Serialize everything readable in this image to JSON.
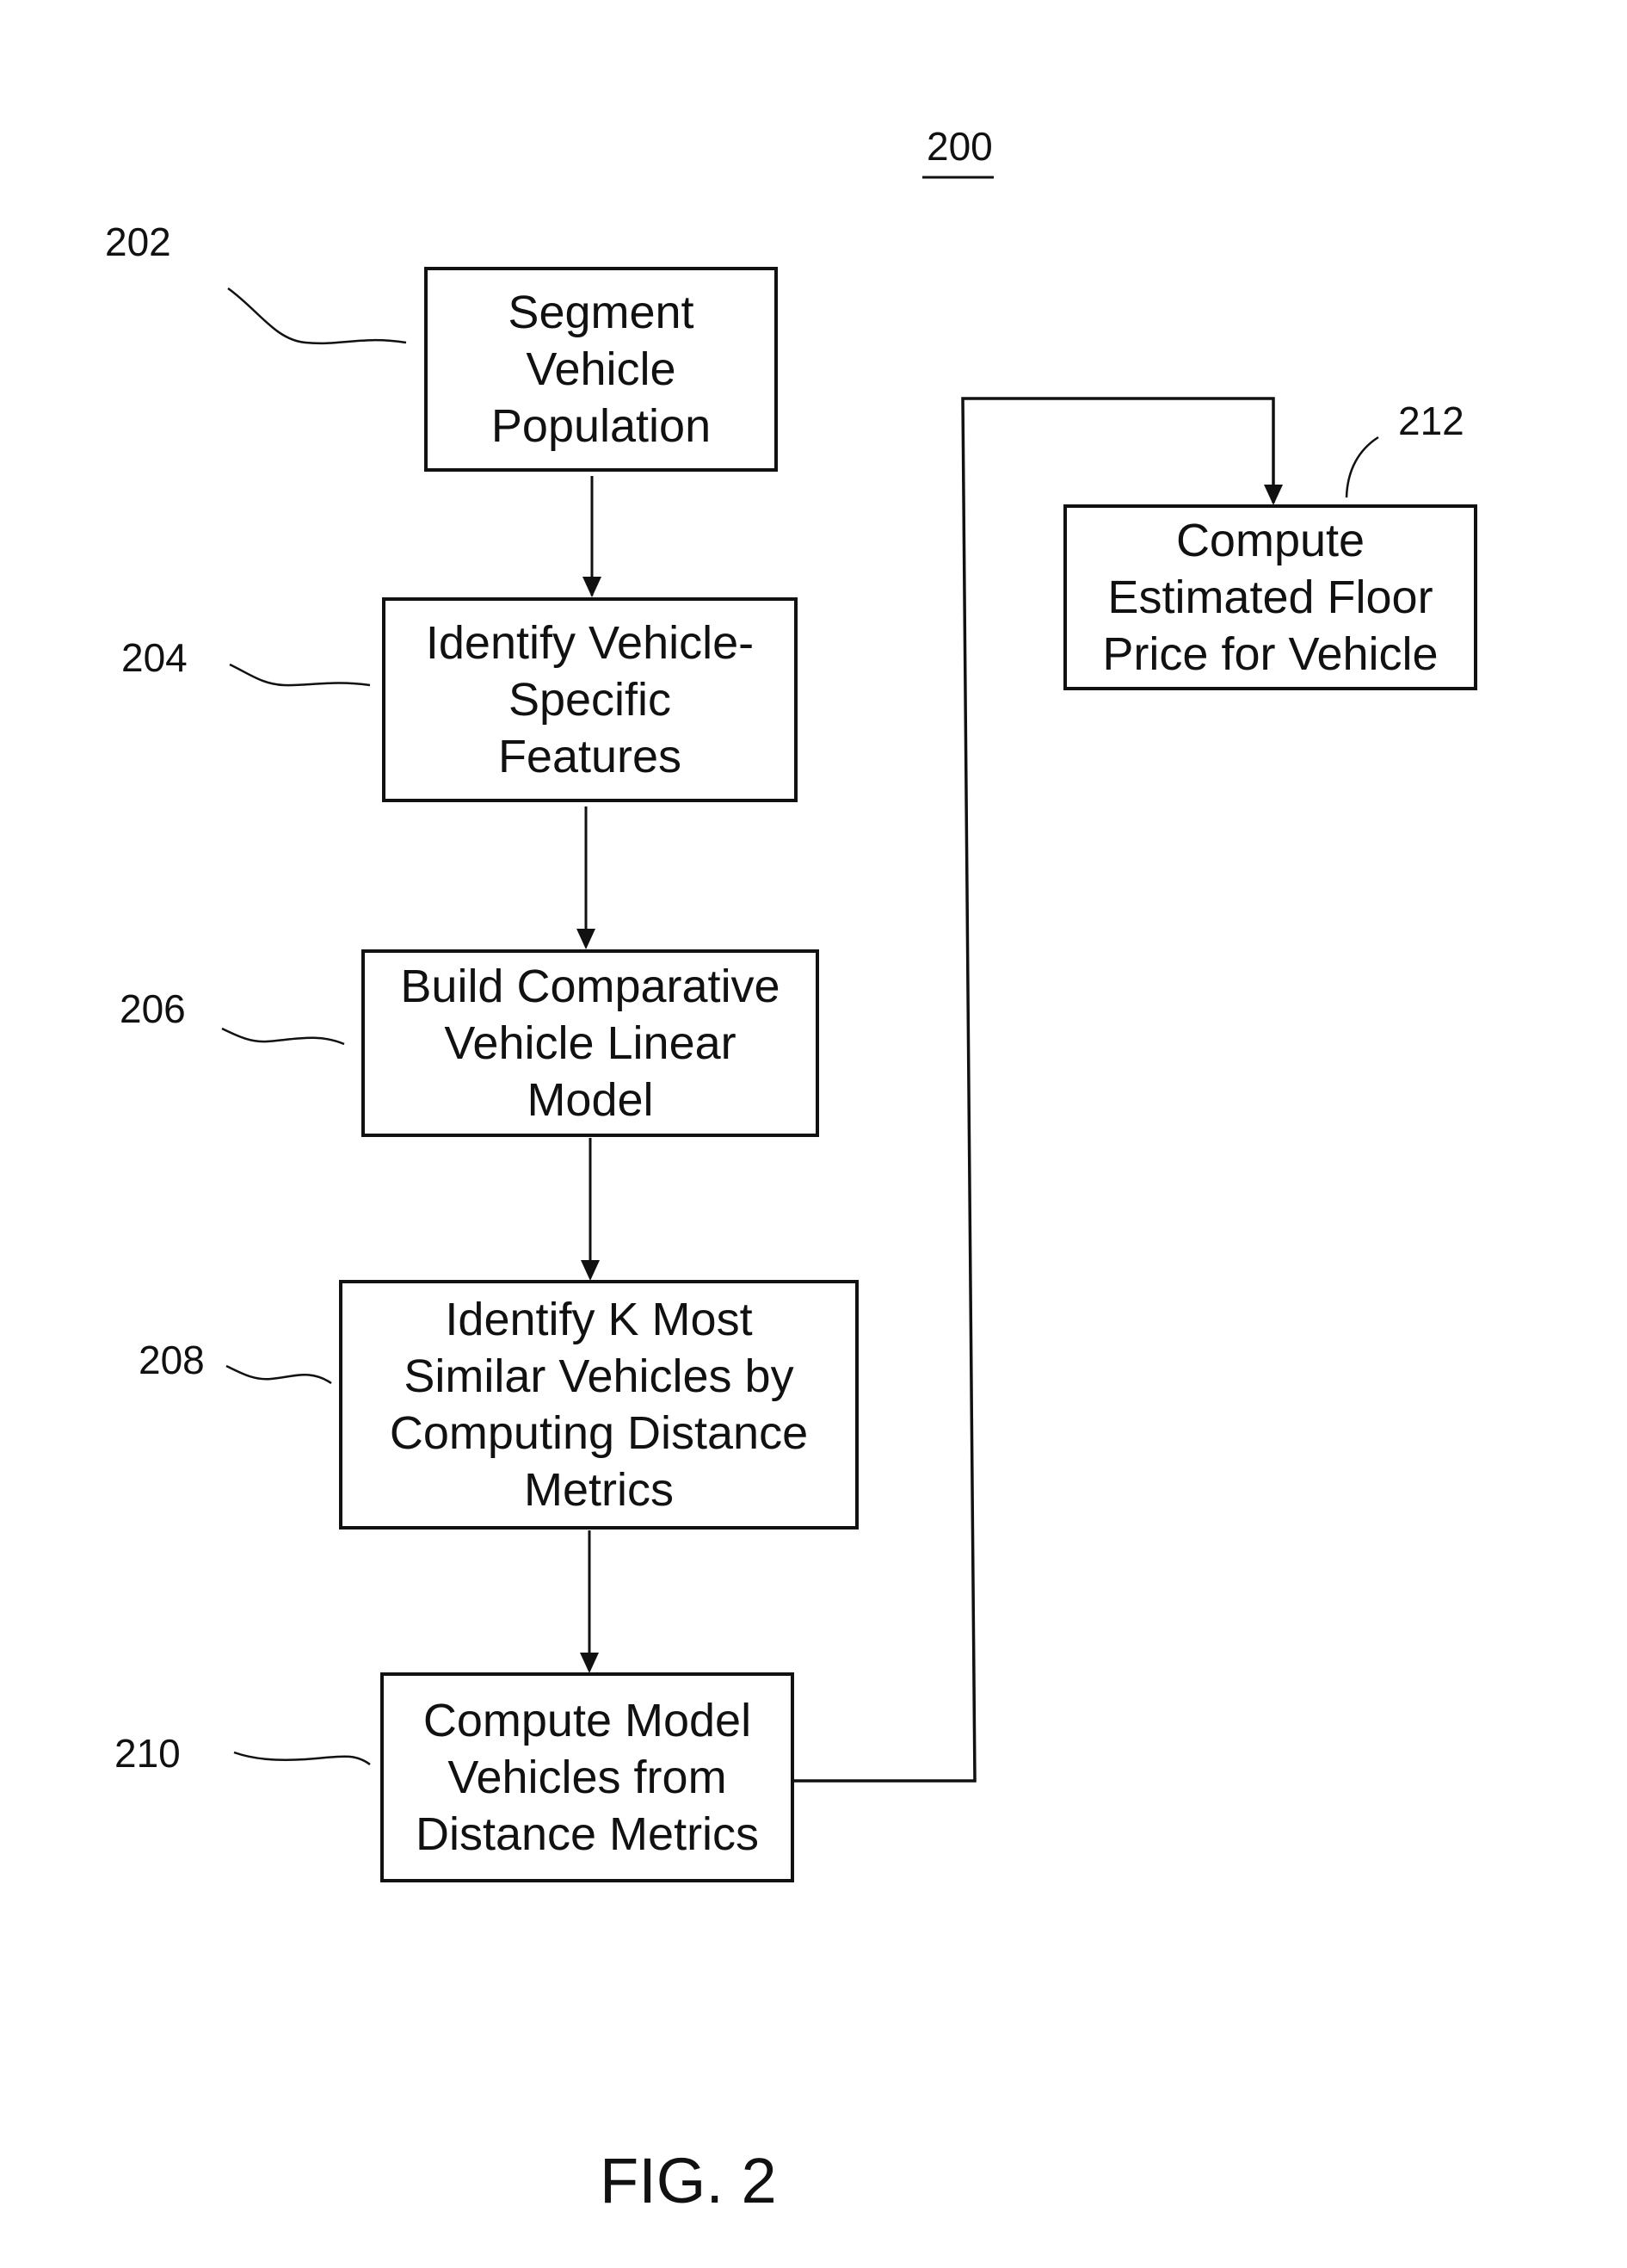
{
  "figure": {
    "title": "FIG. 2",
    "reference": "200"
  },
  "steps": [
    {
      "id": "202",
      "lines": [
        "Segment",
        "Vehicle",
        "Population"
      ]
    },
    {
      "id": "204",
      "lines": [
        "Identify Vehicle-",
        "Specific",
        "Features"
      ]
    },
    {
      "id": "206",
      "lines": [
        "Build Comparative",
        "Vehicle Linear",
        "Model"
      ]
    },
    {
      "id": "208",
      "lines": [
        "Identify K Most",
        "Similar Vehicles by",
        "Computing Distance",
        "Metrics"
      ]
    },
    {
      "id": "210",
      "lines": [
        "Compute Model",
        "Vehicles from",
        "Distance Metrics"
      ]
    },
    {
      "id": "212",
      "lines": [
        "Compute",
        "Estimated Floor",
        "Price for Vehicle"
      ]
    }
  ],
  "flow": [
    {
      "from": "202",
      "to": "204"
    },
    {
      "from": "204",
      "to": "206"
    },
    {
      "from": "206",
      "to": "208"
    },
    {
      "from": "208",
      "to": "210"
    },
    {
      "from": "210",
      "to": "212"
    }
  ]
}
